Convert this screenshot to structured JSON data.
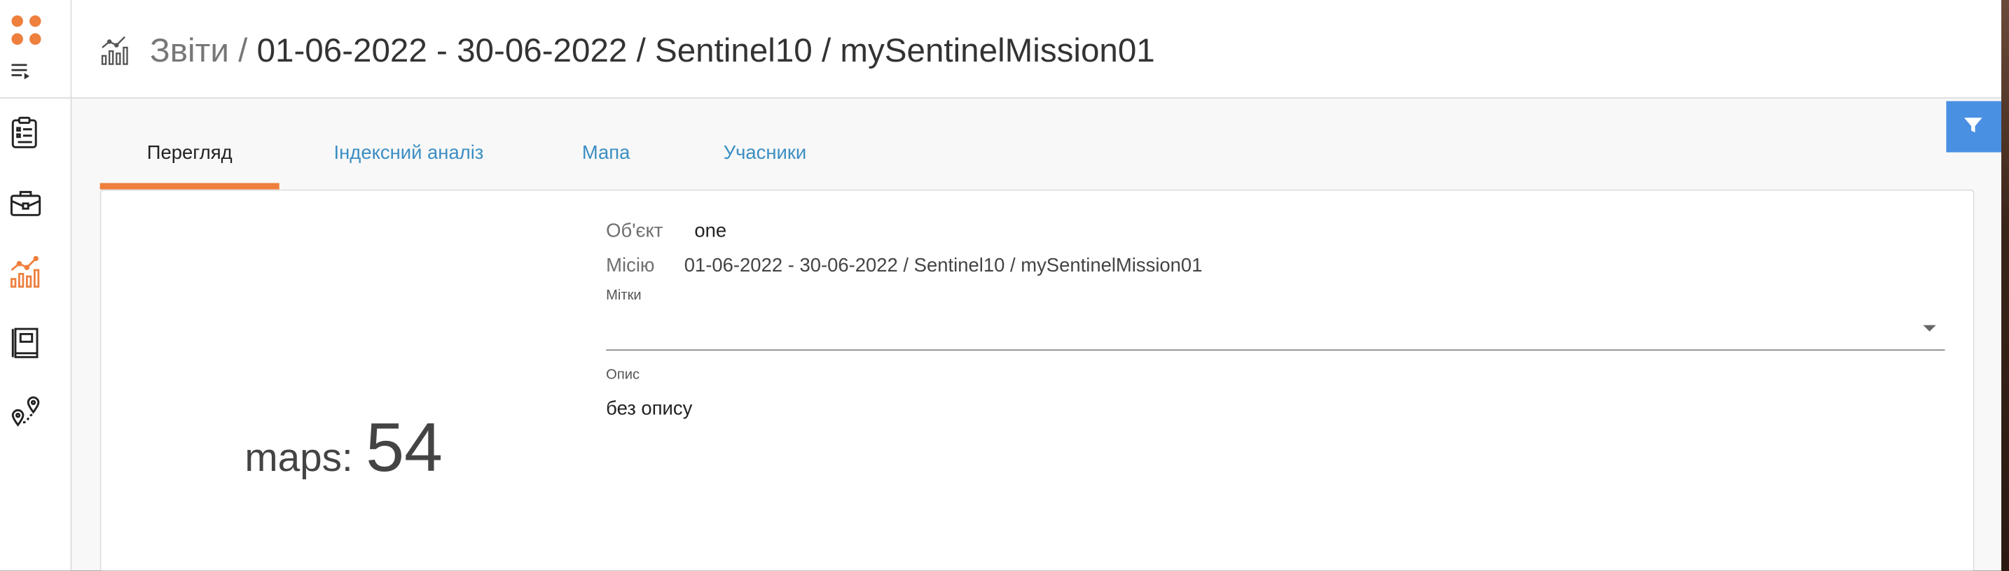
{
  "header": {
    "section": "Звіти",
    "separator": " / ",
    "path": "01-06-2022 - 30-06-2022 / Sentinel10 / mySentinelMission01"
  },
  "tabs": [
    {
      "label": "Перегляд",
      "active": true
    },
    {
      "label": "Індексний аналіз",
      "active": false
    },
    {
      "label": "Мапа",
      "active": false
    },
    {
      "label": "Учасники",
      "active": false
    }
  ],
  "summary": {
    "maps_label": "maps:",
    "maps_value": "54"
  },
  "details": {
    "object_label": "Об'єкт",
    "object_value": "one",
    "mission_label": "Місію",
    "mission_value": "01-06-2022 - 30-06-2022 / Sentinel10 / mySentinelMission01",
    "tags_label": "Мітки",
    "description_label": "Опис",
    "description_value": "без опису"
  },
  "sidebar": {
    "items": [
      {
        "icon": "clipboard-icon",
        "active": false
      },
      {
        "icon": "briefcase-icon",
        "active": false
      },
      {
        "icon": "reports-chart-icon",
        "active": true
      },
      {
        "icon": "book-icon",
        "active": false
      },
      {
        "icon": "route-icon",
        "active": false
      }
    ]
  },
  "colors": {
    "accent": "#ee7f3d",
    "link": "#3c8ec3",
    "filter_button": "#4a90e2"
  }
}
